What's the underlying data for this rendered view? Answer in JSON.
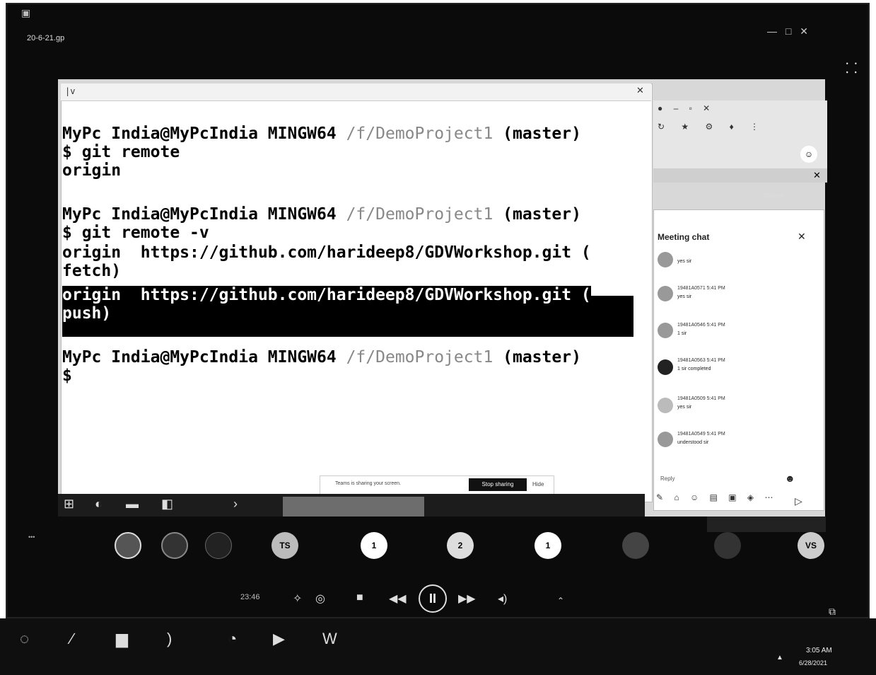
{
  "player": {
    "title": "20-6-21.gp",
    "window_controls": "— □ ✕",
    "grid_icon": "grid-icon"
  },
  "terminal": {
    "lines": [
      {
        "prompt": "MyPc India@MyPcIndia MINGW64 ",
        "path": "/f/DemoProject1",
        "branch": " (master)"
      },
      {
        "cmd": "$ git remote"
      },
      {
        "out": "origin"
      },
      {
        "prompt": "MyPc India@MyPcIndia MINGW64 ",
        "path": "/f/DemoProject1",
        "branch": " (master)"
      },
      {
        "cmd": "$ git remote -v"
      },
      {
        "out": "origin  https://github.com/harideep8/GDVWorkshop.git ("
      },
      {
        "out": "fetch)"
      },
      {
        "out": "origin  https://github.com/harideep8/GDVWorkshop.git ("
      },
      {
        "out": "push)"
      },
      {
        "prompt": "MyPc India@MyPcIndia MINGW64 ",
        "path": "/f/DemoProject1",
        "branch": " (master)"
      },
      {
        "cmd": "$"
      }
    ]
  },
  "share_bar": {
    "message": "Teams is sharing your screen.",
    "stop_label": "Stop sharing",
    "hide_label": "Hide"
  },
  "chat": {
    "dismiss_label": "Dismiss",
    "title": "Meeting chat",
    "messages": [
      {
        "name": "",
        "text": "yes sir"
      },
      {
        "name": "19481A0571  5:41 PM",
        "text": "yes sir"
      },
      {
        "name": "19481A0546  5:41 PM",
        "text": "1 sir"
      },
      {
        "name": "19481A0563  5:41 PM",
        "text": "1 sir completed"
      },
      {
        "name": "19481A0509  5:41 PM",
        "text": "yes sir"
      },
      {
        "name": "19481A0549  5:41 PM",
        "text": "understood sir"
      }
    ],
    "reply_placeholder": "Reply"
  },
  "participants": [
    {
      "initials": "",
      "name": ""
    },
    {
      "initials": "",
      "name": ""
    },
    {
      "initials": "",
      "name": ""
    },
    {
      "initials": "TS",
      "name": ""
    },
    {
      "initials": "1",
      "name": ""
    },
    {
      "initials": "2",
      "name": ""
    },
    {
      "initials": "1",
      "name": ""
    },
    {
      "initials": "",
      "name": ""
    },
    {
      "initials": "",
      "name": ""
    },
    {
      "initials": "VS",
      "name": ""
    }
  ],
  "playback": {
    "time": "23:46"
  },
  "os_taskbar": {
    "clock": "3:05 AM",
    "date": "6/28/2021"
  },
  "colors": {
    "terminal_bg": "#ffffff",
    "selection": "#000000",
    "player_bg": "#0b0b0b"
  }
}
